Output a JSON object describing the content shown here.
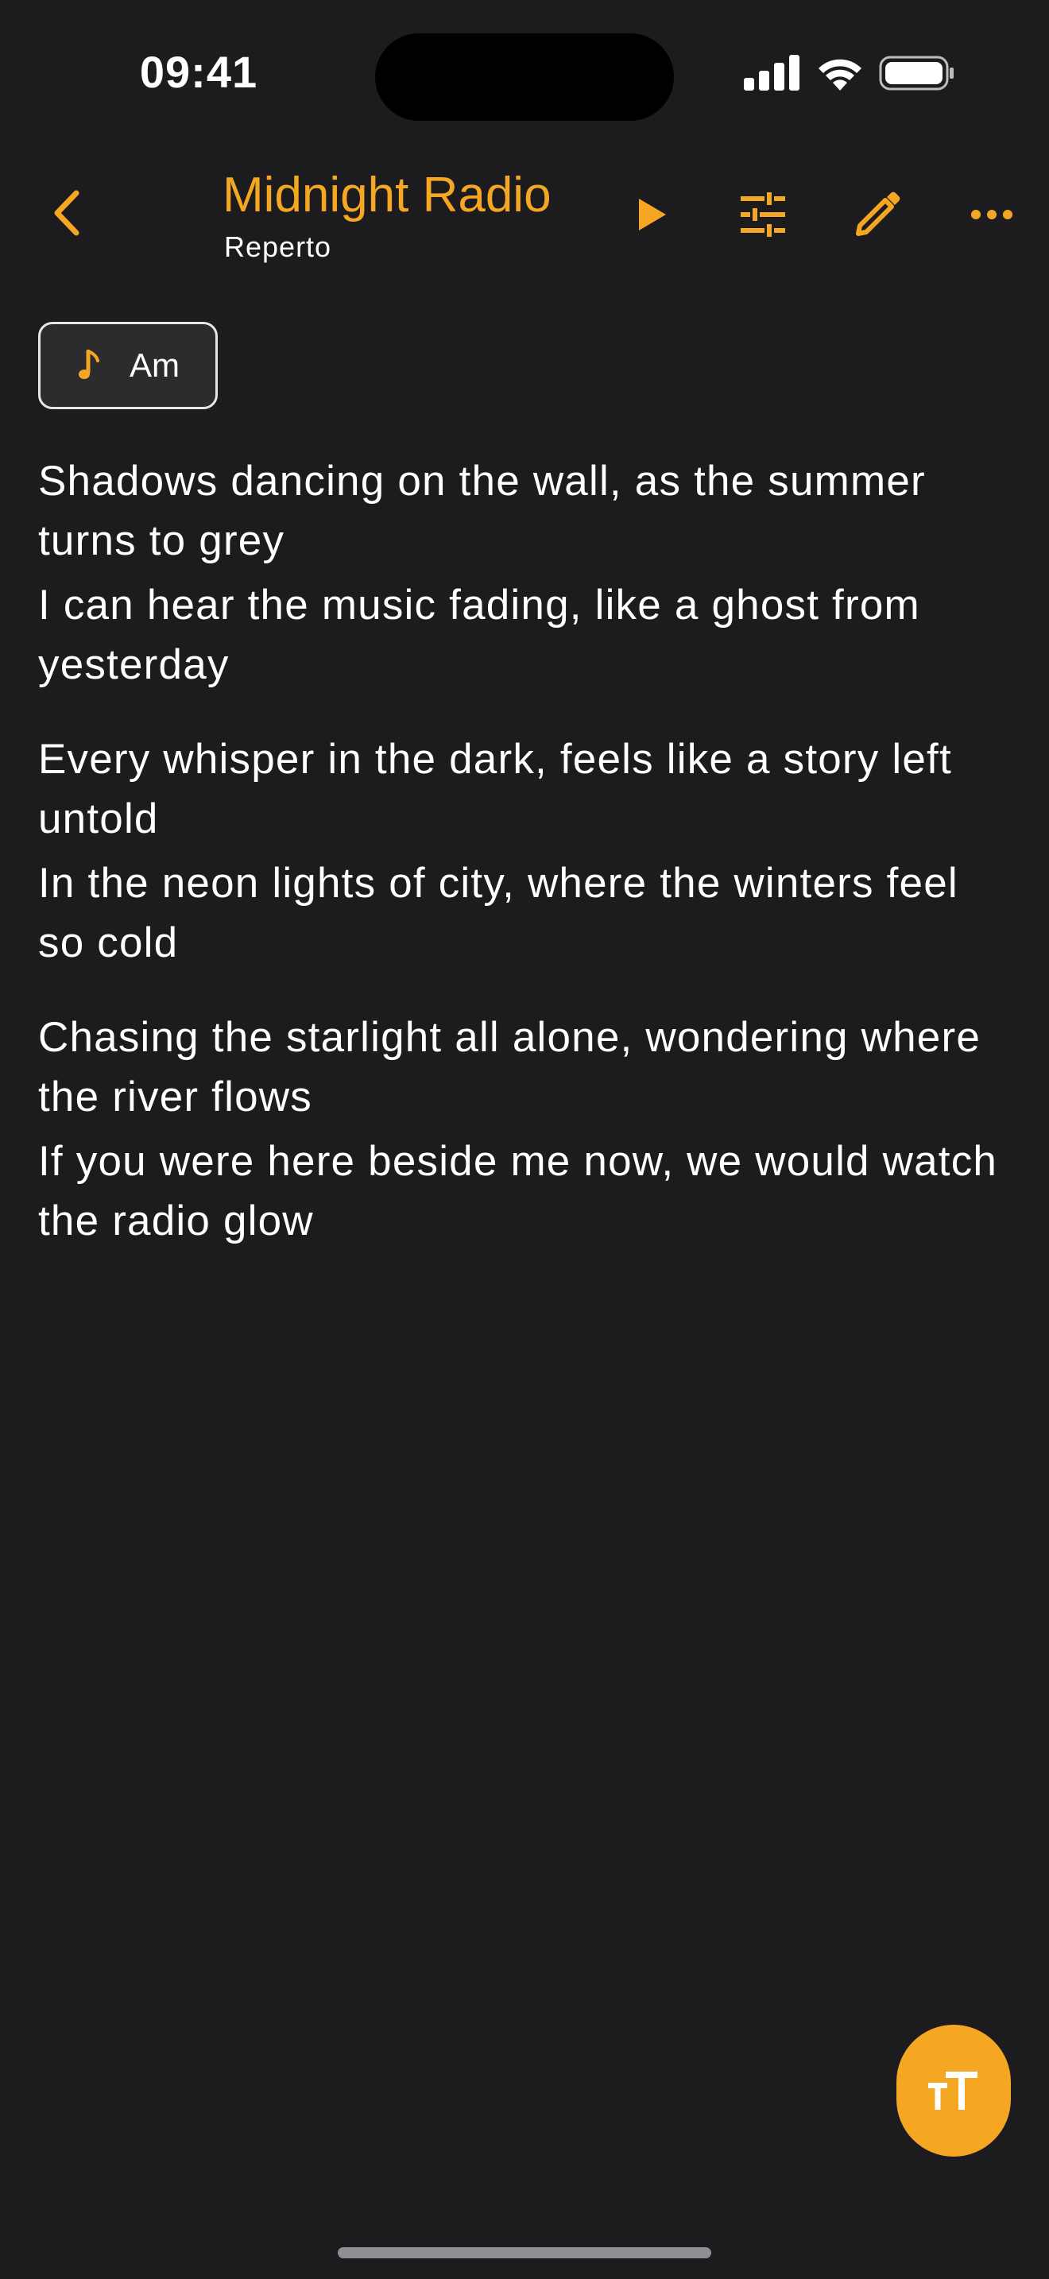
{
  "status_bar": {
    "time": "09:41"
  },
  "header": {
    "title": "Midnight Radio",
    "subtitle": "Reperto",
    "icons": {
      "back": "chevron-left-icon",
      "play": "play-icon",
      "adjust": "sliders-icon",
      "edit": "pencil-icon",
      "more": "ellipsis-icon"
    }
  },
  "key_chip": {
    "label": "Am",
    "icon": "music-note-icon"
  },
  "lyrics": {
    "stanzas": [
      [
        "Shadows dancing on the wall, as the summer turns to grey",
        "I can hear the music fading, like a ghost from yesterday"
      ],
      [
        "Every whisper in the dark, feels like a story left untold",
        "In the neon lights of city, where the winters feel so cold"
      ],
      [
        "Chasing the starlight all alone, wondering where the river flows",
        "If you were here beside me now, we would watch the radio glow"
      ]
    ]
  },
  "fab": {
    "icon": "text-size-icon"
  },
  "colors": {
    "accent": "#f5a623",
    "background": "#1c1c1e",
    "text": "#ffffff",
    "chip_background": "#2c2c2e"
  }
}
